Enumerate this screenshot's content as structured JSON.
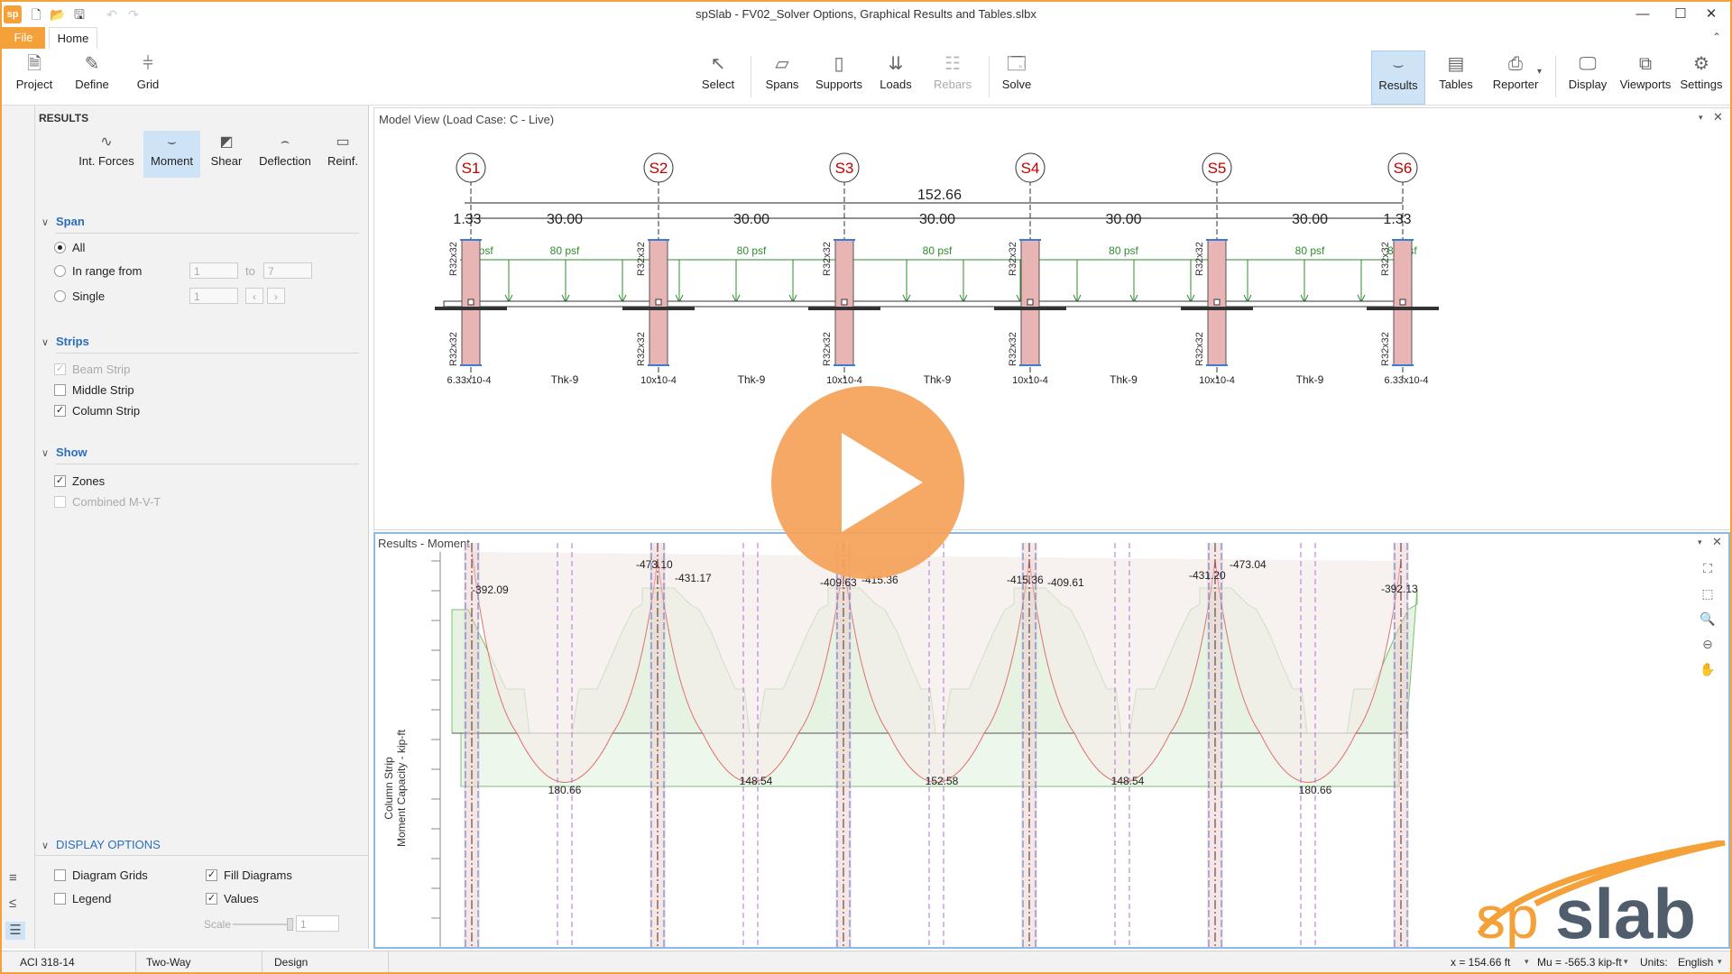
{
  "app": {
    "title": "spSlab - FV02_Solver Options, Graphical Results and Tables.slbx",
    "logo_text": "sp",
    "window_controls": [
      "minimize-icon",
      "maximize-icon",
      "close-icon"
    ]
  },
  "ribbon": {
    "tabs": {
      "file": "File",
      "home": "Home"
    },
    "left_buttons": [
      "Project",
      "Define",
      "Grid"
    ],
    "center_buttons": [
      "Select",
      "Spans",
      "Supports",
      "Loads",
      "Rebars",
      "Solve"
    ],
    "right_buttons": [
      "Results",
      "Tables",
      "Reporter",
      "Display",
      "Viewports",
      "Settings"
    ],
    "selected": "Results",
    "disabled": "Rebars"
  },
  "left_panel": {
    "header": "RESULTS",
    "result_tabs": [
      "Int. Forces",
      "Moment",
      "Shear",
      "Deflection",
      "Reinf."
    ],
    "selected_tab": "Moment",
    "span_section": {
      "title": "Span",
      "all": "All",
      "range": "In range from",
      "range_from": "1",
      "range_to_label": "to",
      "range_to": "7",
      "single": "Single",
      "single_value": "1"
    },
    "strips_section": {
      "title": "Strips",
      "beam": "Beam Strip",
      "middle": "Middle Strip",
      "column": "Column Strip"
    },
    "show_section": {
      "title": "Show",
      "zones": "Zones",
      "combined": "Combined M-V-T"
    },
    "display_options": {
      "title": "DISPLAY OPTIONS",
      "grids": "Diagram Grids",
      "legend": "Legend",
      "fill": "Fill Diagrams",
      "values": "Values",
      "scale": "Scale",
      "scale_value": "1"
    }
  },
  "model_view": {
    "title": "Model View (Load Case: C - Live)",
    "supports": [
      "S1",
      "S2",
      "S3",
      "S4",
      "S5",
      "S6"
    ],
    "total_length": "152.66",
    "cantilever": "1.33",
    "span_lengths": [
      "30.00",
      "30.00",
      "30.00",
      "30.00",
      "30.00"
    ],
    "load_label": "80 psf",
    "column_label": "R32x32",
    "thickness_label": "Thk-9",
    "drop_panel_label": "10x10-4",
    "end_drop_label": "6.33x10-4"
  },
  "results_view": {
    "title": "Results - Moment",
    "y_axis_label_1": "Column Strip",
    "y_axis_label_2": "Moment Capacity - kip-ft",
    "negative_labels": [
      "-392.09",
      "-473.10",
      "-431.17",
      "-409.63",
      "-415.36",
      "-415.36",
      "-409.61",
      "-431.20",
      "-473.04",
      "-392.13"
    ],
    "positive_labels": [
      "180.66",
      "148.54",
      "152.58",
      "148.54",
      "180.66"
    ]
  },
  "status_bar": {
    "code": "ACI 318-14",
    "system": "Two-Way",
    "mode": "Design",
    "x_readout": "x = 154.66 ft",
    "mu_readout": "Mu = -565.3 kip-ft",
    "units_label": "Units:",
    "units_value": "English"
  },
  "brand": {
    "logo_sp": "sp",
    "logo_slab": "slab",
    "orange": "#f5a13a",
    "blue": "#2a6ebb"
  }
}
